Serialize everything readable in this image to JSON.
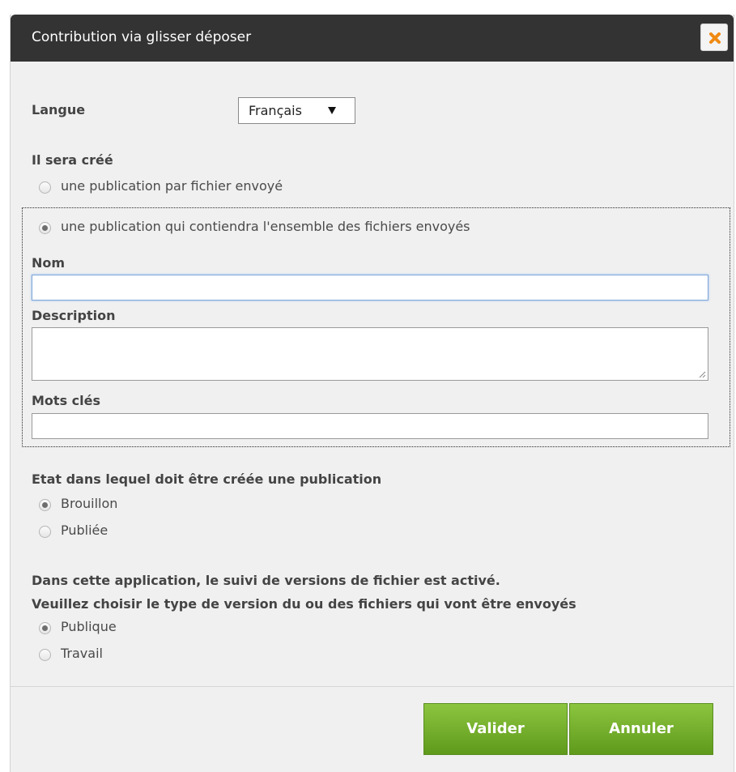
{
  "dialog": {
    "title": "Contribution via glisser déposer",
    "close_icon": "close-icon"
  },
  "language": {
    "label": "Langue",
    "selected": "Français"
  },
  "creation": {
    "heading": "Il sera créé",
    "options": [
      {
        "label": "une publication par fichier envoyé",
        "checked": false
      },
      {
        "label": "une publication qui contiendra l'ensemble des fichiers envoyés",
        "checked": true
      }
    ],
    "name_label": "Nom",
    "name_value": "",
    "description_label": "Description",
    "description_value": "",
    "keywords_label": "Mots clés",
    "keywords_value": ""
  },
  "state": {
    "heading": "Etat dans lequel doit être créée une publication",
    "options": [
      {
        "label": "Brouillon",
        "checked": true
      },
      {
        "label": "Publiée",
        "checked": false
      }
    ]
  },
  "versioning": {
    "line1": "Dans cette application, le suivi de versions de fichier est activé.",
    "line2": "Veuillez choisir le type de version du ou des fichiers qui vont être envoyés",
    "options": [
      {
        "label": "Publique",
        "checked": true
      },
      {
        "label": "Travail",
        "checked": false
      }
    ]
  },
  "buttons": {
    "validate": "Valider",
    "cancel": "Annuler"
  },
  "colors": {
    "titlebar": "#333333",
    "accent_green": "#7ab32e",
    "close_orange": "#f08a12"
  }
}
